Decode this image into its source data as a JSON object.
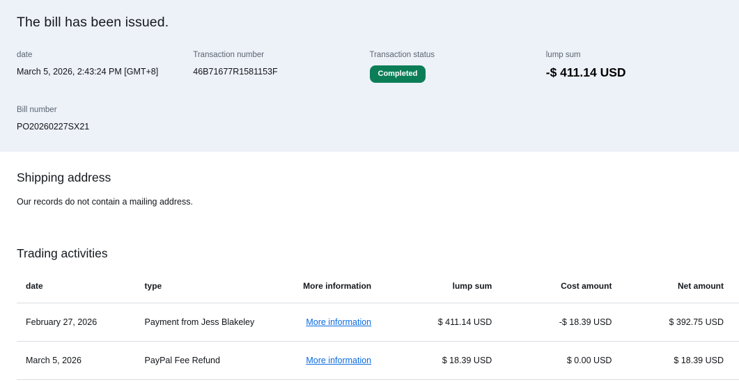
{
  "summary": {
    "title": "The bill has been issued.",
    "fields": {
      "date": {
        "label": "date",
        "value": "March 5, 2026, 2:43:24 PM [GMT+8]"
      },
      "transaction_number": {
        "label": "Transaction number",
        "value": "46B71677R1581153F"
      },
      "transaction_status": {
        "label": "Transaction status",
        "value": "Completed"
      },
      "lump_sum": {
        "label": "lump sum",
        "value": "-$ 411.14 USD"
      },
      "bill_number": {
        "label": "Bill number",
        "value": "PO20260227SX21"
      }
    }
  },
  "shipping": {
    "heading": "Shipping address",
    "message": "Our records do not contain a mailing address."
  },
  "trading": {
    "heading": "Trading activities",
    "columns": {
      "date": "date",
      "type": "type",
      "more_information": "More information",
      "lump_sum": "lump sum",
      "cost_amount": "Cost amount",
      "net_amount": "Net amount"
    },
    "rows": [
      {
        "date": "February 27, 2026",
        "type": "Payment from Jess Blakeley",
        "more_information": "More information",
        "lump_sum": "$ 411.14 USD",
        "cost_amount": "-$ 18.39 USD",
        "net_amount": "$ 392.75 USD"
      },
      {
        "date": "March 5, 2026",
        "type": "PayPal Fee Refund",
        "more_information": "More information",
        "lump_sum": "$ 18.39 USD",
        "cost_amount": "$ 0.00 USD",
        "net_amount": "$ 18.39 USD"
      }
    ]
  },
  "colors": {
    "status_badge_green": "#0c7e57",
    "link_blue": "#0b6be0",
    "summary_background": "#edf1f8",
    "label_gray": "#5a6570",
    "row_border": "#d9dde2"
  }
}
